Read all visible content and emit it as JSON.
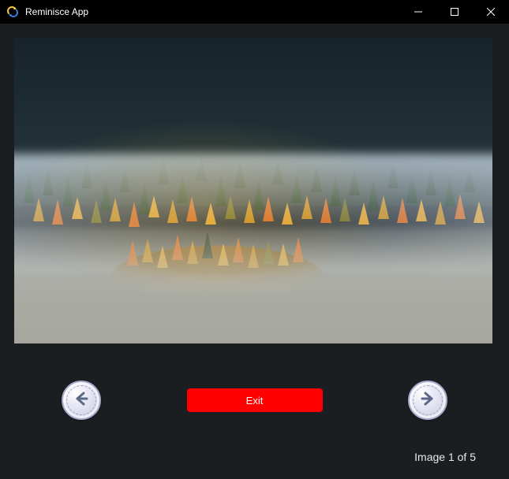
{
  "window": {
    "title": "Reminisce App"
  },
  "viewer": {
    "exit_label": "Exit",
    "counter_text": "Image 1 of 5",
    "current_index": 1,
    "total_images": 5,
    "image_description": "Aerial view of a forested hillside with autumn foliage and low fog"
  }
}
